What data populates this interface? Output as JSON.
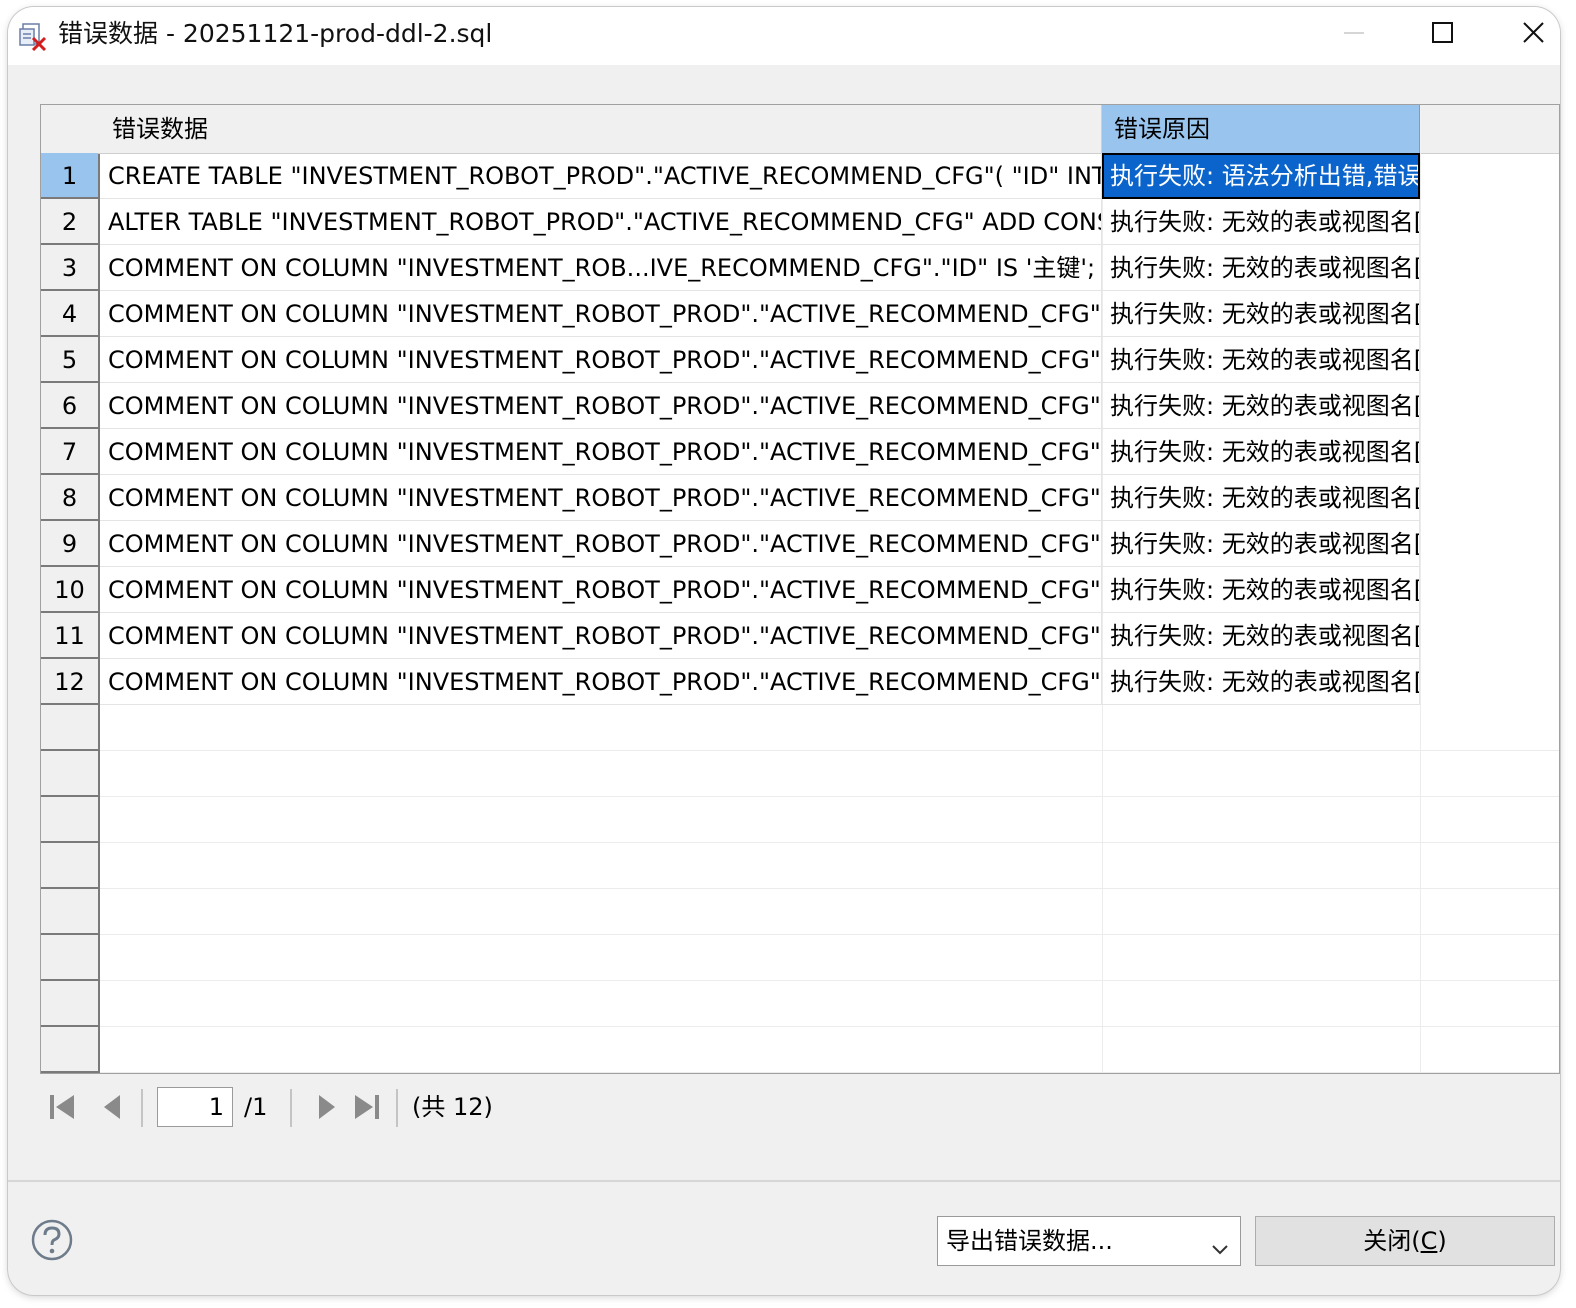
{
  "window": {
    "title": "错误数据 - 20251121-prod-ddl-2.sql"
  },
  "grid": {
    "columns": [
      "错误数据",
      "错误原因"
    ],
    "rows": [
      {
        "num": "1",
        "data": "CREATE TABLE \"INVESTMENT_ROBOT_PROD\".\"ACTIVE_RECOMMEND_CFG\"( \"ID\" INT I",
        "reason": "执行失败: 语法分析出错,错误",
        "selected": true
      },
      {
        "num": "2",
        "data": "ALTER TABLE \"INVESTMENT_ROBOT_PROD\".\"ACTIVE_RECOMMEND_CFG\" ADD CONST",
        "reason": "执行失败: 无效的表或视图名["
      },
      {
        "num": "3",
        "data": "COMMENT ON COLUMN \"INVESTMENT_ROB...IVE_RECOMMEND_CFG\".\"ID\" IS '主键';",
        "reason": "执行失败: 无效的表或视图名["
      },
      {
        "num": "4",
        "data": "COMMENT ON COLUMN \"INVESTMENT_ROBOT_PROD\".\"ACTIVE_RECOMMEND_CFG\"",
        "reason": "执行失败: 无效的表或视图名["
      },
      {
        "num": "5",
        "data": "COMMENT ON COLUMN \"INVESTMENT_ROBOT_PROD\".\"ACTIVE_RECOMMEND_CFG\"",
        "reason": "执行失败: 无效的表或视图名["
      },
      {
        "num": "6",
        "data": "COMMENT ON COLUMN \"INVESTMENT_ROBOT_PROD\".\"ACTIVE_RECOMMEND_CFG\"",
        "reason": "执行失败: 无效的表或视图名["
      },
      {
        "num": "7",
        "data": "COMMENT ON COLUMN \"INVESTMENT_ROBOT_PROD\".\"ACTIVE_RECOMMEND_CFG\"",
        "reason": "执行失败: 无效的表或视图名["
      },
      {
        "num": "8",
        "data": "COMMENT ON COLUMN \"INVESTMENT_ROBOT_PROD\".\"ACTIVE_RECOMMEND_CFG\"",
        "reason": "执行失败: 无效的表或视图名["
      },
      {
        "num": "9",
        "data": "COMMENT ON COLUMN \"INVESTMENT_ROBOT_PROD\".\"ACTIVE_RECOMMEND_CFG\"",
        "reason": "执行失败: 无效的表或视图名["
      },
      {
        "num": "10",
        "data": "COMMENT ON COLUMN \"INVESTMENT_ROBOT_PROD\".\"ACTIVE_RECOMMEND_CFG\"",
        "reason": "执行失败: 无效的表或视图名["
      },
      {
        "num": "11",
        "data": "COMMENT ON COLUMN \"INVESTMENT_ROBOT_PROD\".\"ACTIVE_RECOMMEND_CFG\"",
        "reason": "执行失败: 无效的表或视图名["
      },
      {
        "num": "12",
        "data": "COMMENT ON COLUMN \"INVESTMENT_ROBOT_PROD\".\"ACTIVE_RECOMMEND_CFG\"",
        "reason": "执行失败: 无效的表或视图名["
      }
    ]
  },
  "pager": {
    "current_page": "1",
    "total_pages": "/1",
    "total_count": "(共 12)"
  },
  "footer": {
    "export_label": "导出错误数据...",
    "close_label": "关闭(",
    "close_mnemonic": "C",
    "close_suffix": ")"
  },
  "colors": {
    "selection": "#0a64cc",
    "header_selected": "#99c4ee",
    "window_bg": "#f0f0f0"
  },
  "icons": {
    "title": "error-data-icon",
    "first": "first-page-icon",
    "prev": "prev-page-icon",
    "next": "next-page-icon",
    "last": "last-page-icon",
    "help": "help-icon",
    "dropdown": "chevron-down-icon"
  }
}
